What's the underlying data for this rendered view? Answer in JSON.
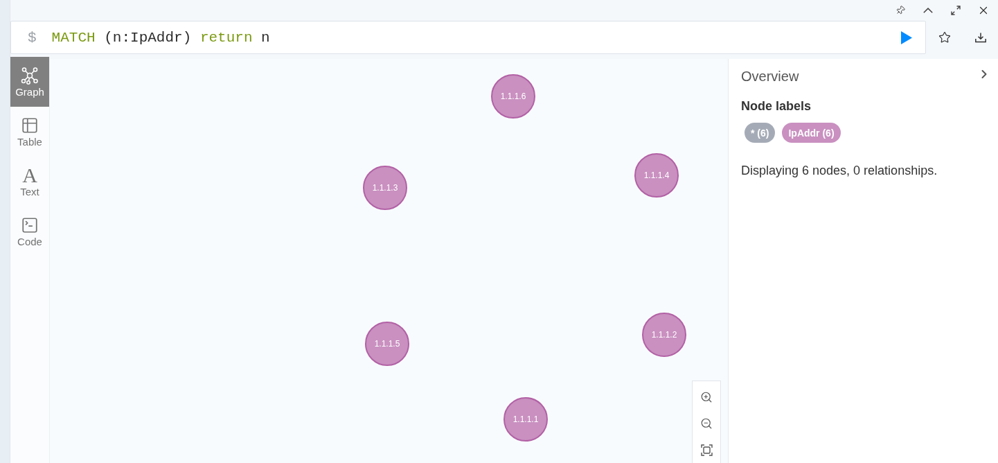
{
  "editor": {
    "prompt": "$",
    "tokens": [
      {
        "text": "MATCH",
        "kind": "keyword"
      },
      {
        "text": "(n:IpAddr)",
        "kind": "plain"
      },
      {
        "text": "return",
        "kind": "keyword"
      },
      {
        "text": "n",
        "kind": "plain"
      }
    ]
  },
  "view_tabs": [
    {
      "label": "Graph",
      "kind": "graph",
      "selected": true
    },
    {
      "label": "Table",
      "kind": "table",
      "selected": false
    },
    {
      "label": "Text",
      "kind": "text",
      "glyph": "A",
      "selected": false
    },
    {
      "label": "Code",
      "kind": "code",
      "selected": false
    }
  ],
  "graph": {
    "nodes": [
      {
        "label": "1.1.1.6"
      },
      {
        "label": "1.1.1.3"
      },
      {
        "label": "1.1.1.4"
      },
      {
        "label": "1.1.1.5"
      },
      {
        "label": "1.1.1.2"
      },
      {
        "label": "1.1.1.1"
      }
    ]
  },
  "overview": {
    "title": "Overview",
    "section": "Node labels",
    "labels": [
      {
        "text": "* (6)",
        "color": "#a5abb6"
      },
      {
        "text": "IpAddr (6)",
        "color": "#c990c0"
      }
    ],
    "summary": "Displaying 6 nodes, 0 relationships."
  }
}
